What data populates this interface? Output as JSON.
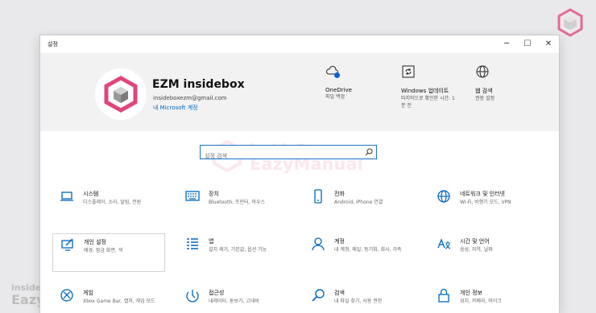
{
  "watermark": {
    "line1": "insideBox",
    "line2": "EazyManual"
  },
  "window": {
    "title": "설정",
    "controls": {
      "minimize": "─",
      "maximize": "☐",
      "close": "✕"
    }
  },
  "account": {
    "name": "EZM insidebox",
    "email": "insideboxezm@gmail.com",
    "link": "내 Microsoft 계정"
  },
  "quick": [
    {
      "title": "OneDrive",
      "sub": "파일 백업",
      "icon": "cloud-icon"
    },
    {
      "title": "Windows 업데이트",
      "sub": "마지막으로 확인한 시간: 1분 전",
      "icon": "sync-icon"
    },
    {
      "title": "웹 검색",
      "sub": "권장 설정",
      "icon": "globe-icon"
    }
  ],
  "search": {
    "placeholder": "설정 검색"
  },
  "tiles": [
    {
      "title": "시스템",
      "sub": "디스플레이, 소리, 알림, 전원",
      "icon": "laptop-icon"
    },
    {
      "title": "장치",
      "sub": "Bluetooth, 프린터, 마우스",
      "icon": "keyboard-icon"
    },
    {
      "title": "전화",
      "sub": "Android, iPhone 연결",
      "icon": "phone-icon"
    },
    {
      "title": "네트워크 및 인터넷",
      "sub": "Wi-Fi, 비행기 모드, VPN",
      "icon": "globe-icon"
    },
    {
      "title": "개인 설정",
      "sub": "배경, 잠금 화면, 색",
      "icon": "personalization-icon"
    },
    {
      "title": "앱",
      "sub": "설치 제거, 기본값, 옵션 기능",
      "icon": "apps-list-icon"
    },
    {
      "title": "계정",
      "sub": "내 계정, 메일, 동기화, 회사, 가족",
      "icon": "person-icon"
    },
    {
      "title": "시간 및 언어",
      "sub": "음성, 지역, 날짜",
      "icon": "language-icon"
    },
    {
      "title": "게임",
      "sub": "Xbox Game Bar, 캡처, 게임 모드",
      "icon": "xbox-icon"
    },
    {
      "title": "접근성",
      "sub": "내레이터, 돋보기, 고대비",
      "icon": "ease-of-access-icon"
    },
    {
      "title": "검색",
      "sub": "내 파일 찾기, 사용 권한",
      "icon": "search-icon"
    },
    {
      "title": "개인 정보",
      "sub": "위치, 카메라, 마이크",
      "icon": "lock-icon"
    }
  ],
  "colors": {
    "accent": "#0067c0",
    "brand": "#e0457a"
  }
}
